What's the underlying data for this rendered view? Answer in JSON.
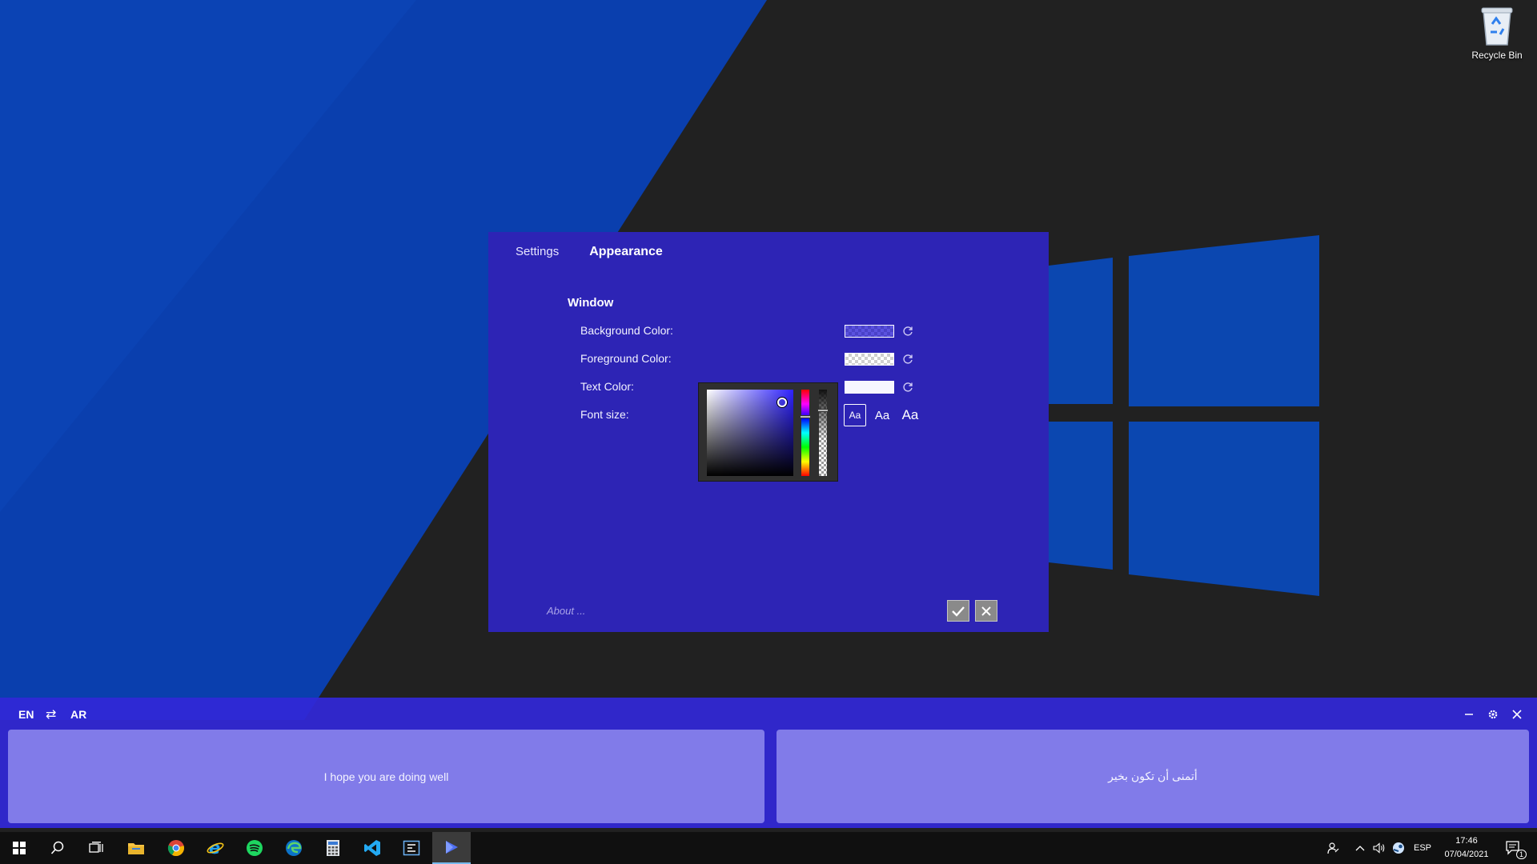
{
  "desktop": {
    "recycle_bin_label": "Recycle Bin"
  },
  "settings_dialog": {
    "tabs": [
      {
        "label": "Settings",
        "active": false
      },
      {
        "label": "Appearance",
        "active": true
      }
    ],
    "section_title": "Window",
    "rows": {
      "background_color": {
        "label": "Background Color:"
      },
      "foreground_color": {
        "label": "Foreground Color:"
      },
      "text_color": {
        "label": "Text Color:"
      },
      "font_size": {
        "label": "Font size:",
        "options": [
          "Aa",
          "Aa",
          "Aa"
        ],
        "selected_index": 0
      }
    },
    "color_picker": {
      "hue_color": "#2e22ff"
    },
    "about_label": "About ...",
    "colors": {
      "dialog_bg": "#2d24b5",
      "button_bg": "#8a8a8a"
    }
  },
  "translator": {
    "source_lang": "EN",
    "swap_symbol": "⇄",
    "target_lang": "AR",
    "source_text": "I hope you are doing well",
    "target_text": "أتمنى أن تكون بخير"
  },
  "taskbar": {
    "apps": [
      "start",
      "search",
      "task-view",
      "file-explorer",
      "chrome",
      "internet-explorer",
      "spotify",
      "edge",
      "calculator",
      "vscode",
      "code-app",
      "translator-app"
    ],
    "active_app": "translator-app",
    "language": "ESP",
    "time": "17:46",
    "date": "07/04/2021",
    "notification_count": "1"
  }
}
